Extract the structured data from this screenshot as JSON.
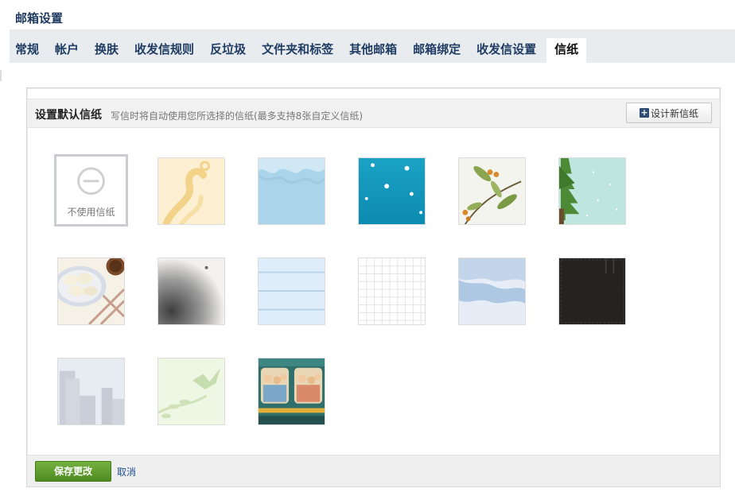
{
  "page_title": "邮箱设置",
  "tabs": [
    {
      "label": "常规",
      "active": false
    },
    {
      "label": "帐户",
      "active": false
    },
    {
      "label": "换肤",
      "active": false
    },
    {
      "label": "收发信规则",
      "active": false
    },
    {
      "label": "反垃圾",
      "active": false
    },
    {
      "label": "文件夹和标签",
      "active": false
    },
    {
      "label": "其他邮箱",
      "active": false
    },
    {
      "label": "邮箱绑定",
      "active": false
    },
    {
      "label": "收发信设置",
      "active": false
    },
    {
      "label": "信纸",
      "active": true
    }
  ],
  "panel": {
    "title": "设置默认信纸",
    "description": "写信时将自动使用您所选择的信纸(最多支持8张自定义信纸)",
    "design_button": "设计新信纸",
    "design_icon": "plus-icon"
  },
  "stationery": {
    "none_label": "不使用信纸",
    "none_icon": "no-stationery-icon",
    "items": [
      "golden-swirl",
      "blue-waves",
      "teal-snowflakes",
      "olive-branch",
      "christmas-tree",
      "dumplings-plate",
      "gray-fur",
      "blue-lined",
      "grid-paper",
      "blue-hills",
      "dark-leather",
      "city-skyline",
      "hummingbird-branch",
      "train-passengers"
    ]
  },
  "footer": {
    "save_label": "保存更改",
    "cancel_label": "取消"
  },
  "colors": {
    "accent": "#1f3c63",
    "save_button": "#5f9c2e",
    "tab_bar": "#e9ecef"
  }
}
